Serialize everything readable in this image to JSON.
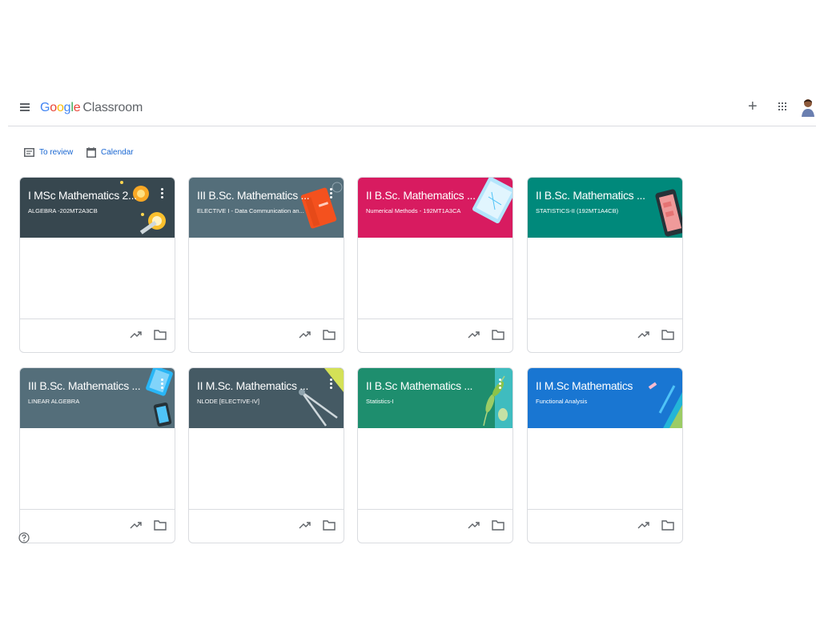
{
  "header": {
    "logo_google": [
      "G",
      "o",
      "o",
      "g",
      "l",
      "e"
    ],
    "logo_product": "Classroom",
    "create_label": "+"
  },
  "nav": {
    "to_review": "To review",
    "calendar": "Calendar"
  },
  "colors": {
    "accent": "#1967d2",
    "dark_slate": "#37474f",
    "slate": "#546e7a",
    "pink": "#d81b60",
    "teal": "#00897b",
    "green": "#1e8e6e",
    "blue": "#1976d2"
  },
  "classes": [
    {
      "title": "I MSc Mathematics 2...",
      "subtitle": "ALGEBRA -202MT2A3CB",
      "color": "#37474f",
      "art": "math-tools-illustration"
    },
    {
      "title": "III B.Sc. Mathematics ...",
      "subtitle": "ELECTIVE I - Data Communication an...",
      "color": "#546e7a",
      "art": "notebook-illustration"
    },
    {
      "title": "II B.Sc. Mathematics ...",
      "subtitle": "Numerical Methods - 192MT1A3CA",
      "color": "#d81b60",
      "art": "tablet-illustration"
    },
    {
      "title": "II B.Sc. Mathematics ...",
      "subtitle": "STATISTICS-II (192MT1A4CB)",
      "color": "#00897b",
      "art": "phone-illustration"
    },
    {
      "title": "III B.Sc. Mathematics ...",
      "subtitle": "LINEAR ALGEBRA",
      "color": "#546e7a",
      "art": "devices-illustration"
    },
    {
      "title": "II M.Sc. Mathematics ...",
      "subtitle": "NLODE [ELECTIVE-IV]",
      "color": "#455a64",
      "art": "compass-illustration"
    },
    {
      "title": "II B.Sc Mathematics ...",
      "subtitle": "Statistics-I",
      "color": "#1e8e6e",
      "art": "leaves-illustration"
    },
    {
      "title": "II M.Sc Mathematics",
      "subtitle": "Functional Analysis",
      "color": "#1976d2",
      "art": "pencil-illustration"
    }
  ]
}
